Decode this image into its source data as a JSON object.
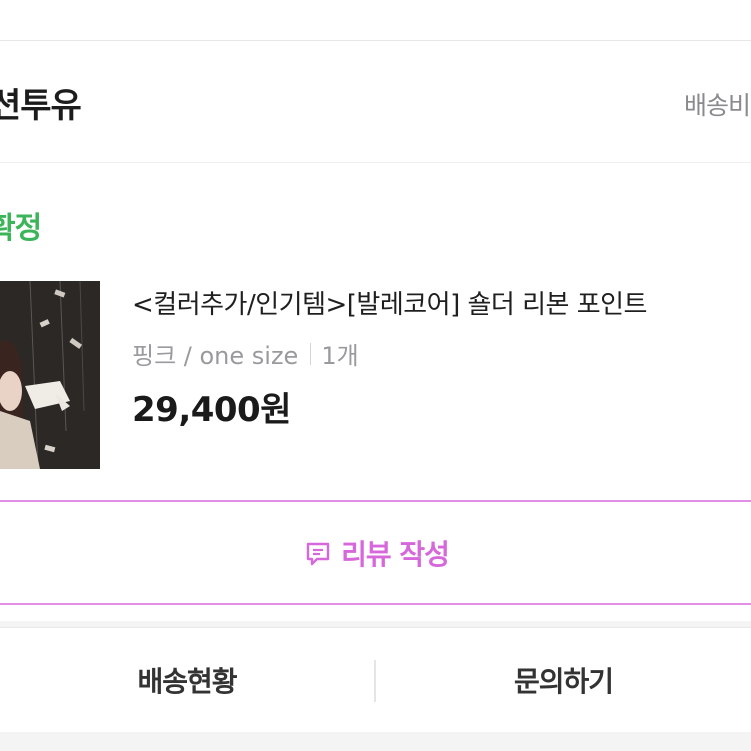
{
  "store": {
    "name": "션투유",
    "shipping_link": "배송비"
  },
  "order": {
    "status": "확정"
  },
  "product": {
    "title": "<컬러추가/인기템>[발레코어] 숄더 리본 포인트",
    "option": "핑크 / one size",
    "quantity": "1개",
    "price": "29,400원"
  },
  "actions": {
    "review_label": "리뷰 작성"
  },
  "bottom_bar": {
    "tracking_label": "배송현황",
    "inquiry_label": "문의하기"
  },
  "colors": {
    "status_green": "#3cb55a",
    "review_pink": "#d768dc",
    "review_border": "#e08fe4"
  }
}
